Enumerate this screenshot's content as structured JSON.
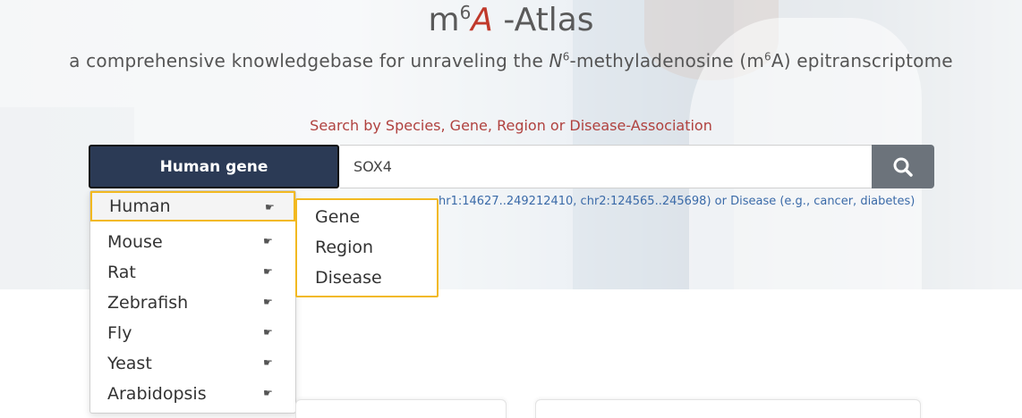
{
  "header": {
    "title_m": "m",
    "title_sup": "6",
    "title_a": "A",
    "title_rest": " -Atlas",
    "subtitle_pre": "a comprehensive knowledgebase for unraveling the ",
    "subtitle_n": "N",
    "subtitle_sup": "6",
    "subtitle_mid": "-methyladenosine (m",
    "subtitle_sup2": "6",
    "subtitle_post": "A) epitranscriptome"
  },
  "search": {
    "hint": "Search by Species, Gene, Region or Disease-Association",
    "category_label": "Human gene",
    "value": "SOX4",
    "example": "hr1:14627..249212410, chr2:124565..245698) or Disease (e.g., cancer, diabetes)",
    "button_icon": "search-icon"
  },
  "species_menu": {
    "items": [
      {
        "label": "Human",
        "icon": "pointing-hand-icon"
      },
      {
        "label": "Mouse",
        "icon": "pointing-hand-icon"
      },
      {
        "label": "Rat",
        "icon": "pointing-hand-icon"
      },
      {
        "label": "Zebrafish",
        "icon": "pointing-hand-icon"
      },
      {
        "label": "Fly",
        "icon": "pointing-hand-icon"
      },
      {
        "label": "Yeast",
        "icon": "pointing-hand-icon"
      },
      {
        "label": "Arabidopsis",
        "icon": "pointing-hand-icon"
      }
    ],
    "hand_glyph": "☛",
    "active": "Human"
  },
  "sub_menu": {
    "items": [
      "Gene",
      "Region",
      "Disease"
    ]
  },
  "colors": {
    "category_bg": "#2b3a55",
    "highlight": "#f2b920",
    "hint": "#b0413e",
    "search_button": "#6c737b"
  }
}
